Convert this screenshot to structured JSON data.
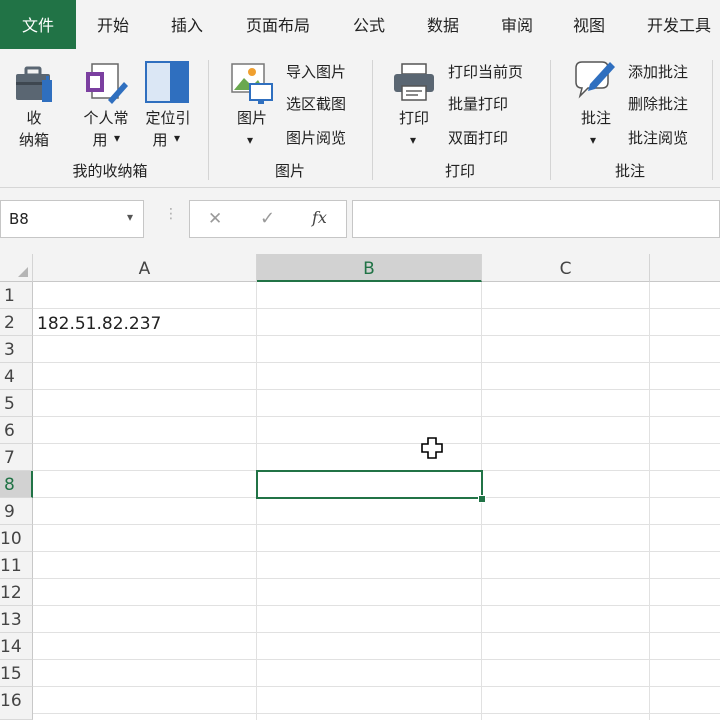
{
  "tabs": [
    {
      "label": "文件",
      "active": true
    },
    {
      "label": "开始"
    },
    {
      "label": "插入"
    },
    {
      "label": "页面布局"
    },
    {
      "label": "公式"
    },
    {
      "label": "数据"
    },
    {
      "label": "审阅"
    },
    {
      "label": "视图"
    },
    {
      "label": "开发工具"
    }
  ],
  "ribbon": {
    "box": {
      "collect_line1": "收",
      "collect_line2": "纳箱",
      "personal_line1": "个人常",
      "personal_line2": "用",
      "locate_line1": "定位引",
      "locate_line2": "用",
      "group_label": "我的收纳箱"
    },
    "picture": {
      "big_label": "图片",
      "import": "导入图片",
      "screenshot": "选区截图",
      "browse": "图片阅览",
      "group_label": "图片"
    },
    "print": {
      "big_label": "打印",
      "current": "打印当前页",
      "batch": "批量打印",
      "duplex": "双面打印",
      "group_label": "打印"
    },
    "comment": {
      "big_label": "批注",
      "add": "添加批注",
      "delete": "删除批注",
      "browse": "批注阅览",
      "group_label": "批注"
    },
    "dropdown_arrow": "▾"
  },
  "formula_bar": {
    "name_box": "B8",
    "cancel_icon": "✕",
    "confirm_icon": "✓",
    "fx_label": "fx",
    "formula_value": ""
  },
  "sheet": {
    "columns": [
      "A",
      "B",
      "C"
    ],
    "rows": [
      "1",
      "2",
      "3",
      "4",
      "5",
      "6",
      "7",
      "8",
      "9",
      "10",
      "11",
      "12",
      "13",
      "14",
      "15",
      "16"
    ],
    "cell_A2": "182.51.82.237",
    "active_cell": "B8"
  },
  "colors": {
    "accent": "#217346",
    "ribbon_bg": "#f3f3f3"
  }
}
